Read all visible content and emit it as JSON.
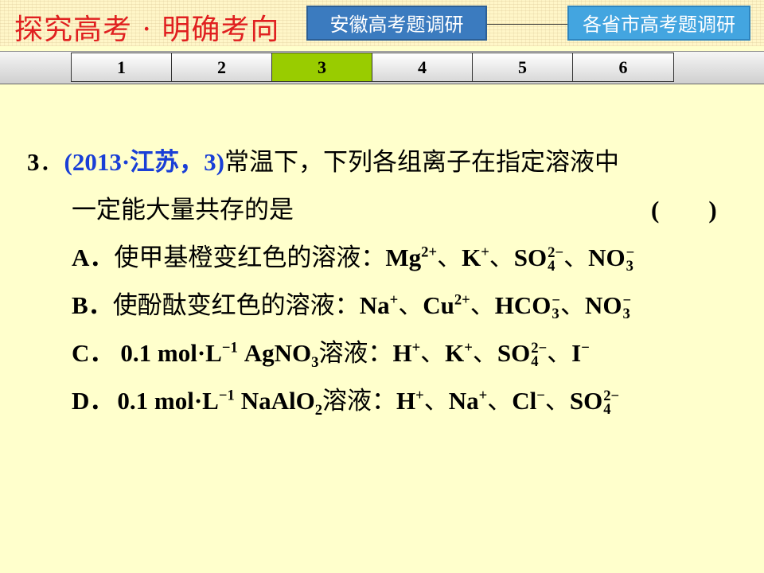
{
  "header": {
    "brand": "探究高考 · 明确考向",
    "button_anhui": "安徽高考题调研",
    "button_provinces": "各省市高考题调研"
  },
  "tabs": [
    "1",
    "2",
    "3",
    "4",
    "5",
    "6"
  ],
  "active_tab": "3",
  "question": {
    "number": "3",
    "source": "(2013·江苏，3)",
    "stem_line1": "常温下，下列各组离子在指定溶液中",
    "stem_line2": "一定能大量共存的是",
    "answer_paren": "(　　)",
    "options": {
      "A": {
        "label": "A．",
        "condition": "使甲基橙变红色的溶液："
      },
      "B": {
        "label": "B．",
        "condition": "使酚酞变红色的溶液："
      },
      "C": {
        "label": "C．",
        "conc": "0.1 mol·L",
        "solution": "溶液："
      },
      "D": {
        "label": "D．",
        "conc": "0.1 mol·L",
        "solution": "溶液："
      }
    },
    "separator": "、"
  }
}
